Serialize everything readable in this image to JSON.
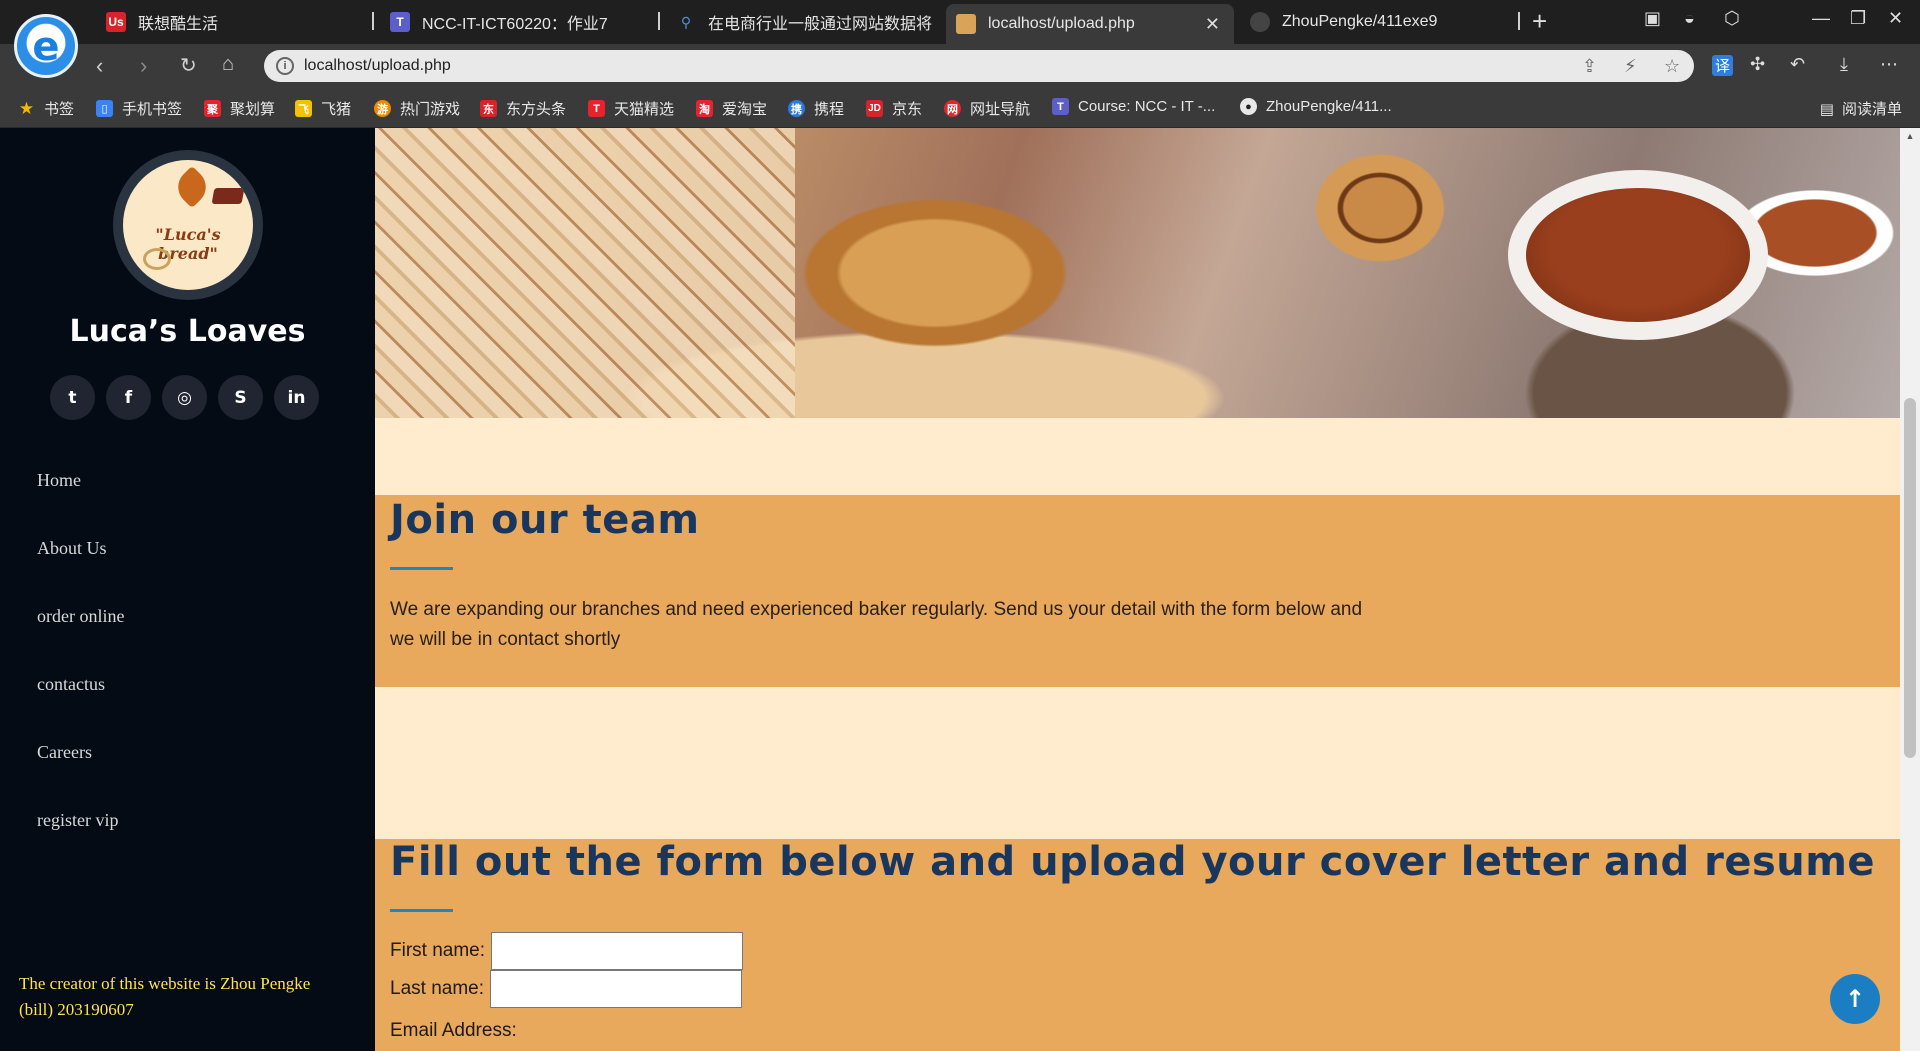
{
  "browser": {
    "tabs": [
      {
        "label": "联想酷生活",
        "favicon": "Us",
        "favicon_color": "#d8232a"
      },
      {
        "label": "NCC-IT-ICT60220：作业7",
        "favicon": "T",
        "favicon_color": "#5b5fc7"
      },
      {
        "label": "在电商行业一般通过网站数据将",
        "favicon": "🔍",
        "favicon_color": "#2b2b2b"
      },
      {
        "label": "localhost/upload.php",
        "favicon": "▣",
        "favicon_color": "#d9a45a",
        "active": true
      },
      {
        "label": "ZhouPengke/411exe9",
        "favicon": "●",
        "favicon_color": "#222222"
      }
    ],
    "new_tab_icon": "plus-icon",
    "url": "localhost/upload.php",
    "bookmarks": [
      {
        "label": "书签",
        "icon": "star-icon",
        "color": "#f5b800"
      },
      {
        "label": "手机书签",
        "icon": "phone-icon",
        "color": "#3b82f6"
      },
      {
        "label": "聚划算",
        "icon": "聚",
        "color": "#e5242b"
      },
      {
        "label": "飞猪",
        "icon": "飞",
        "color": "#f5c100"
      },
      {
        "label": "热门游戏",
        "icon": "游",
        "color": "#f08a00"
      },
      {
        "label": "东方头条",
        "icon": "东",
        "color": "#d8232a"
      },
      {
        "label": "天猫精选",
        "icon": "T",
        "color": "#e5242b"
      },
      {
        "label": "爱淘宝",
        "icon": "淘",
        "color": "#e5242b"
      },
      {
        "label": "携程",
        "icon": "携",
        "color": "#2a7ae2"
      },
      {
        "label": "京东",
        "icon": "JD",
        "color": "#d8232a"
      },
      {
        "label": "网址导航",
        "icon": "网",
        "color": "#e5242b"
      },
      {
        "label": "Course: NCC - IT -...",
        "icon": "T",
        "color": "#5b5fc7"
      },
      {
        "label": "ZhouPengke/411...",
        "icon": "●",
        "color": "#ffffff"
      }
    ],
    "reading_list": "阅读清单"
  },
  "sidebar": {
    "logo_text": "\"Luca's bread\"",
    "site_name": "Luca’s Loaves",
    "socials": [
      {
        "name": "twitter",
        "glyph": "t"
      },
      {
        "name": "facebook",
        "glyph": "f"
      },
      {
        "name": "instagram",
        "glyph": "◎"
      },
      {
        "name": "skype",
        "glyph": "S"
      },
      {
        "name": "linkedin",
        "glyph": "in"
      }
    ],
    "nav": [
      "Home",
      "About Us",
      "order online",
      "contactus",
      "Careers",
      "register vip"
    ],
    "credit": "The creator of this website is Zhou Pengke (bill) 203190607"
  },
  "main": {
    "join": {
      "title": "Join our team",
      "text": "We are expanding our branches and need experienced baker regularly. Send us your detail with the form below and we will be in contact shortly"
    },
    "form": {
      "title": "Fill out the form below and upload your cover letter and resume",
      "first_name_label": "First name:",
      "last_name_label": "Last name:",
      "email_label": "Email Address:",
      "first_name_value": "",
      "last_name_value": ""
    }
  },
  "colors": {
    "sidebar_bg": "#040b14",
    "section_bg": "#e8a95c",
    "page_bg": "#ffeccf",
    "heading": "#18365e",
    "accent": "#1b87c9",
    "credit": "#ffe34d"
  }
}
